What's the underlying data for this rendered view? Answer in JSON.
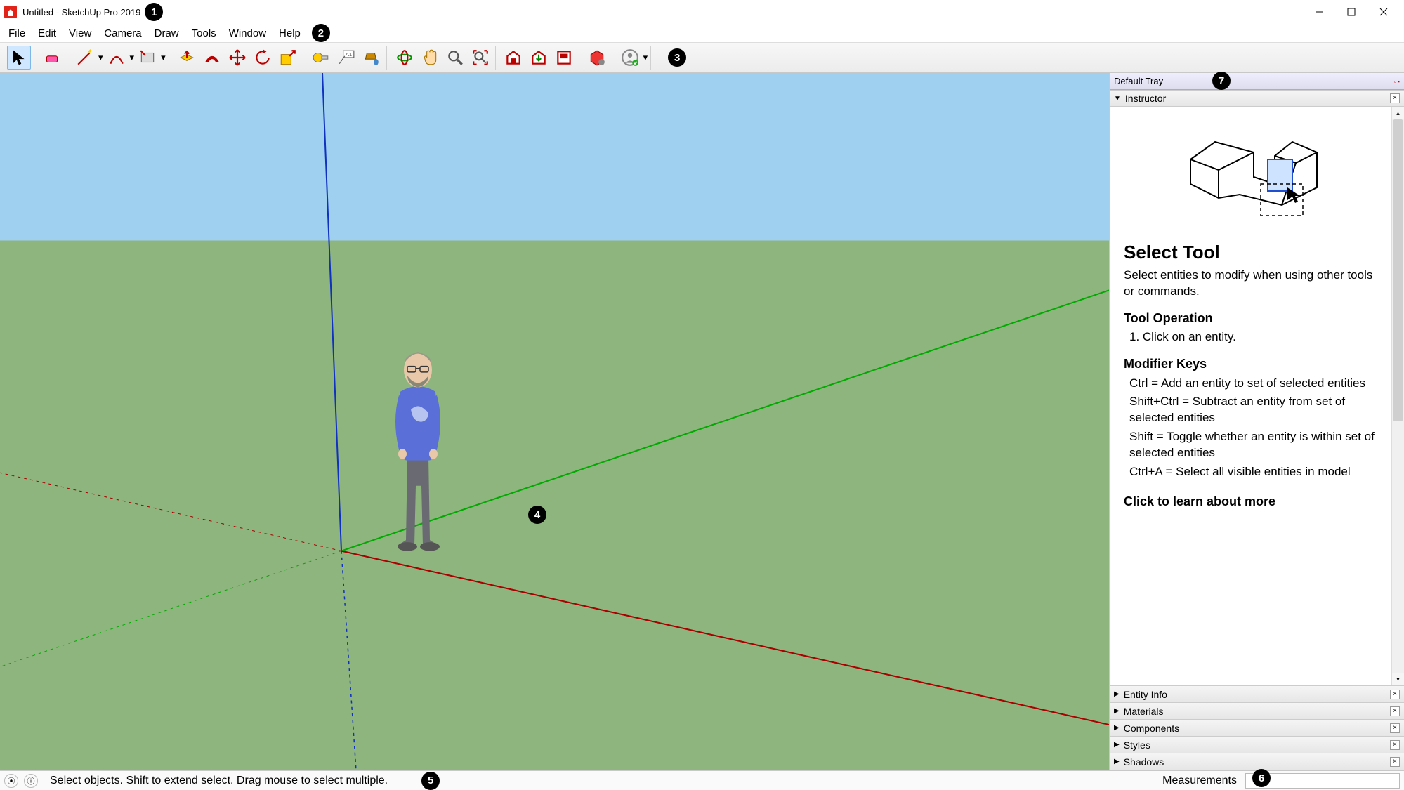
{
  "titlebar": {
    "title": "Untitled - SketchUp Pro 2019"
  },
  "menus": [
    "File",
    "Edit",
    "View",
    "Camera",
    "Draw",
    "Tools",
    "Window",
    "Help"
  ],
  "annotations": [
    "1",
    "2",
    "3",
    "4",
    "5",
    "6",
    "7"
  ],
  "toolbar": {
    "tools": [
      {
        "name": "select",
        "color": "#000"
      },
      {
        "name": "eraser",
        "color": "#e66"
      },
      {
        "name": "line",
        "color": "#c00",
        "dd": true
      },
      {
        "name": "arc",
        "color": "#c00",
        "dd": true
      },
      {
        "name": "rectangle",
        "color": "#888",
        "dd": true
      },
      {
        "name": "pushpull",
        "color": "#c90"
      },
      {
        "name": "offset",
        "color": "#c00"
      },
      {
        "name": "move",
        "color": "#c00"
      },
      {
        "name": "rotate",
        "color": "#c00"
      },
      {
        "name": "scale",
        "color": "#c00"
      },
      {
        "name": "tape",
        "color": "#888"
      },
      {
        "name": "text",
        "color": "#555"
      },
      {
        "name": "paint",
        "color": "#a70"
      },
      {
        "name": "orbit",
        "color": "#090"
      },
      {
        "name": "pan",
        "color": "#c90"
      },
      {
        "name": "zoom",
        "color": "#555"
      },
      {
        "name": "zoom-extents",
        "color": "#555"
      },
      {
        "name": "warehouse",
        "color": "#c00"
      },
      {
        "name": "warehouse-get",
        "color": "#c00"
      },
      {
        "name": "layout",
        "color": "#c00"
      },
      {
        "name": "extension",
        "color": "#b00"
      },
      {
        "name": "account",
        "color": "#777"
      }
    ]
  },
  "tray": {
    "title": "Default Tray",
    "open_panel": "Instructor",
    "instructor": {
      "tool_title": "Select Tool",
      "tool_desc": "Select entities to modify when using other tools or commands.",
      "op_title": "Tool Operation",
      "op_item": "1. Click on an entity.",
      "mod_title": "Modifier Keys",
      "mod_1": "Ctrl = Add an entity to set of selected entities",
      "mod_2": "Shift+Ctrl = Subtract an entity from set of selected entities",
      "mod_3": "Shift = Toggle whether an entity is within set of selected entities",
      "mod_4": "Ctrl+A = Select all visible entities in model",
      "learn": "Click to learn about more"
    },
    "panels": [
      "Entity Info",
      "Materials",
      "Components",
      "Styles",
      "Shadows"
    ]
  },
  "status": {
    "help_text": "Select objects. Shift to extend select. Drag mouse to select multiple.",
    "measurements_label": "Measurements"
  }
}
